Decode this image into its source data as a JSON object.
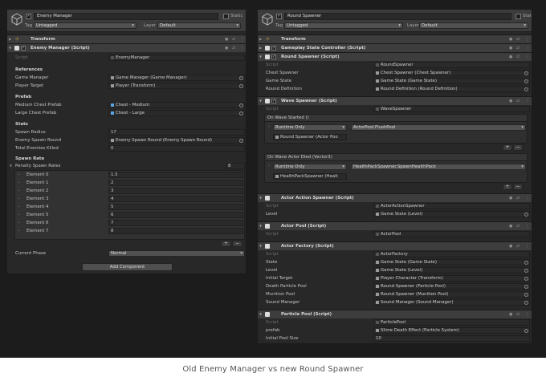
{
  "caption": "Old Enemy Manager vs new Round Spawner",
  "left": {
    "object_name": "Enemy Manager",
    "static_label": "Static",
    "tag_label": "Tag",
    "tag_value": "Untagged",
    "layer_label": "Layer",
    "layer_value": "Default",
    "transform": {
      "title": "Transform"
    },
    "script_comp": {
      "title": "Enemy Manager (Script)"
    },
    "script_label": "Script",
    "script_value": "EnemyManager",
    "references_header": "References",
    "game_manager_label": "Game Manager",
    "game_manager_value": "Game Manager (Game Manager)",
    "player_target_label": "Player Target",
    "player_target_value": "Player (Transform)",
    "prefab_header": "Prefab",
    "medium_chest_label": "Medium Chest Prefab",
    "medium_chest_value": "Chest - Medium",
    "large_chest_label": "Large Chest Prefab",
    "large_chest_value": "Chest - Large",
    "stats_header": "Stats",
    "spawn_radius_label": "Spawn Radius",
    "spawn_radius_value": "17",
    "enemy_spawn_round_label": "Enemy Spawn Round",
    "enemy_spawn_round_value": "Enemy Spawn Round (Enemy Spawn Round)",
    "total_killed_label": "Total Enemies Killed",
    "total_killed_value": "0",
    "spawn_rate_header": "Spawn Rate",
    "penalty_label": "Penalty Spawn Rates",
    "penalty_count": "8",
    "elements": [
      {
        "label": "Element 0",
        "value": "1.5"
      },
      {
        "label": "Element 1",
        "value": "2"
      },
      {
        "label": "Element 2",
        "value": "3"
      },
      {
        "label": "Element 3",
        "value": "4"
      },
      {
        "label": "Element 4",
        "value": "5"
      },
      {
        "label": "Element 5",
        "value": "6"
      },
      {
        "label": "Element 6",
        "value": "7"
      },
      {
        "label": "Element 7",
        "value": "8"
      }
    ],
    "plus": "+",
    "minus": "−",
    "current_phase_label": "Current Phase",
    "current_phase_value": "Normal",
    "add_component": "Add Component"
  },
  "right": {
    "object_name": "Round Spawner",
    "static_label": "Static",
    "tag_label": "Tag",
    "tag_value": "Untagged",
    "layer_label": "Layer",
    "layer_value": "Default",
    "transform": {
      "title": "Transform"
    },
    "gsc": {
      "title": "Gameplay State Controller (Script)"
    },
    "rs": {
      "title": "Round Spawner (Script)",
      "script_label": "Script",
      "script_value": "RoundSpawner",
      "chest_label": "Chest Spawner",
      "chest_value": "Chest Spawner (Chest Spawner)",
      "gs_label": "Game State",
      "gs_value": "Game State (Game State)",
      "rd_label": "Round Definition",
      "rd_value": "Round Definition (Round Definition)"
    },
    "ws": {
      "title": "Wave Spawner (Script)",
      "script_label": "Script",
      "script_value": "WaveSpawner",
      "evt1_header": "On Wave Started ()",
      "evt1_runtime": "Runtime Only",
      "evt1_func": "ActorPool.FlushPool",
      "evt1_obj": "Round Spawner (Actor Poo",
      "evt2_header": "On Wave Actor Died (Vector3)",
      "evt2_runtime": "Runtime Only",
      "evt2_func": "HealthPackSpawner.SpawnHealthPack",
      "evt2_obj": "HealthPackSpawner (Healt"
    },
    "aas": {
      "title": "Actor Action Spawner (Script)",
      "script_label": "Script",
      "script_value": "ActorActionSpawner",
      "level_label": "Level",
      "level_value": "Game State (Level)"
    },
    "ap": {
      "title": "Actor Pool (Script)",
      "script_label": "Script",
      "script_value": "ActorPool"
    },
    "af": {
      "title": "Actor Factory (Script)",
      "script_label": "Script",
      "script_value": "ActorFactory",
      "state_label": "State",
      "state_value": "Game State (Game State)",
      "level_label": "Level",
      "level_value": "Game State (Level)",
      "target_label": "Initial Target",
      "target_value": "Player Character (Transform)",
      "dpp_label": "Death Particle Pool",
      "dpp_value": "Round Spawner (Particle Pool)",
      "mp_label": "Munition Pool",
      "mp_value": "Round Spawner (Munition Pool)",
      "sm_label": "Sound Manager",
      "sm_value": "Sound Manager (Sound Manager)"
    },
    "pp": {
      "title": "Particle Pool (Script)",
      "script_label": "Script",
      "script_value": "ParticlePool",
      "prefab_label": "prefab",
      "prefab_value": "Slime Death Effect (Particle System)",
      "size_label": "Initial Pool Size",
      "size_value": "10"
    },
    "plus": "+",
    "minus": "−"
  }
}
